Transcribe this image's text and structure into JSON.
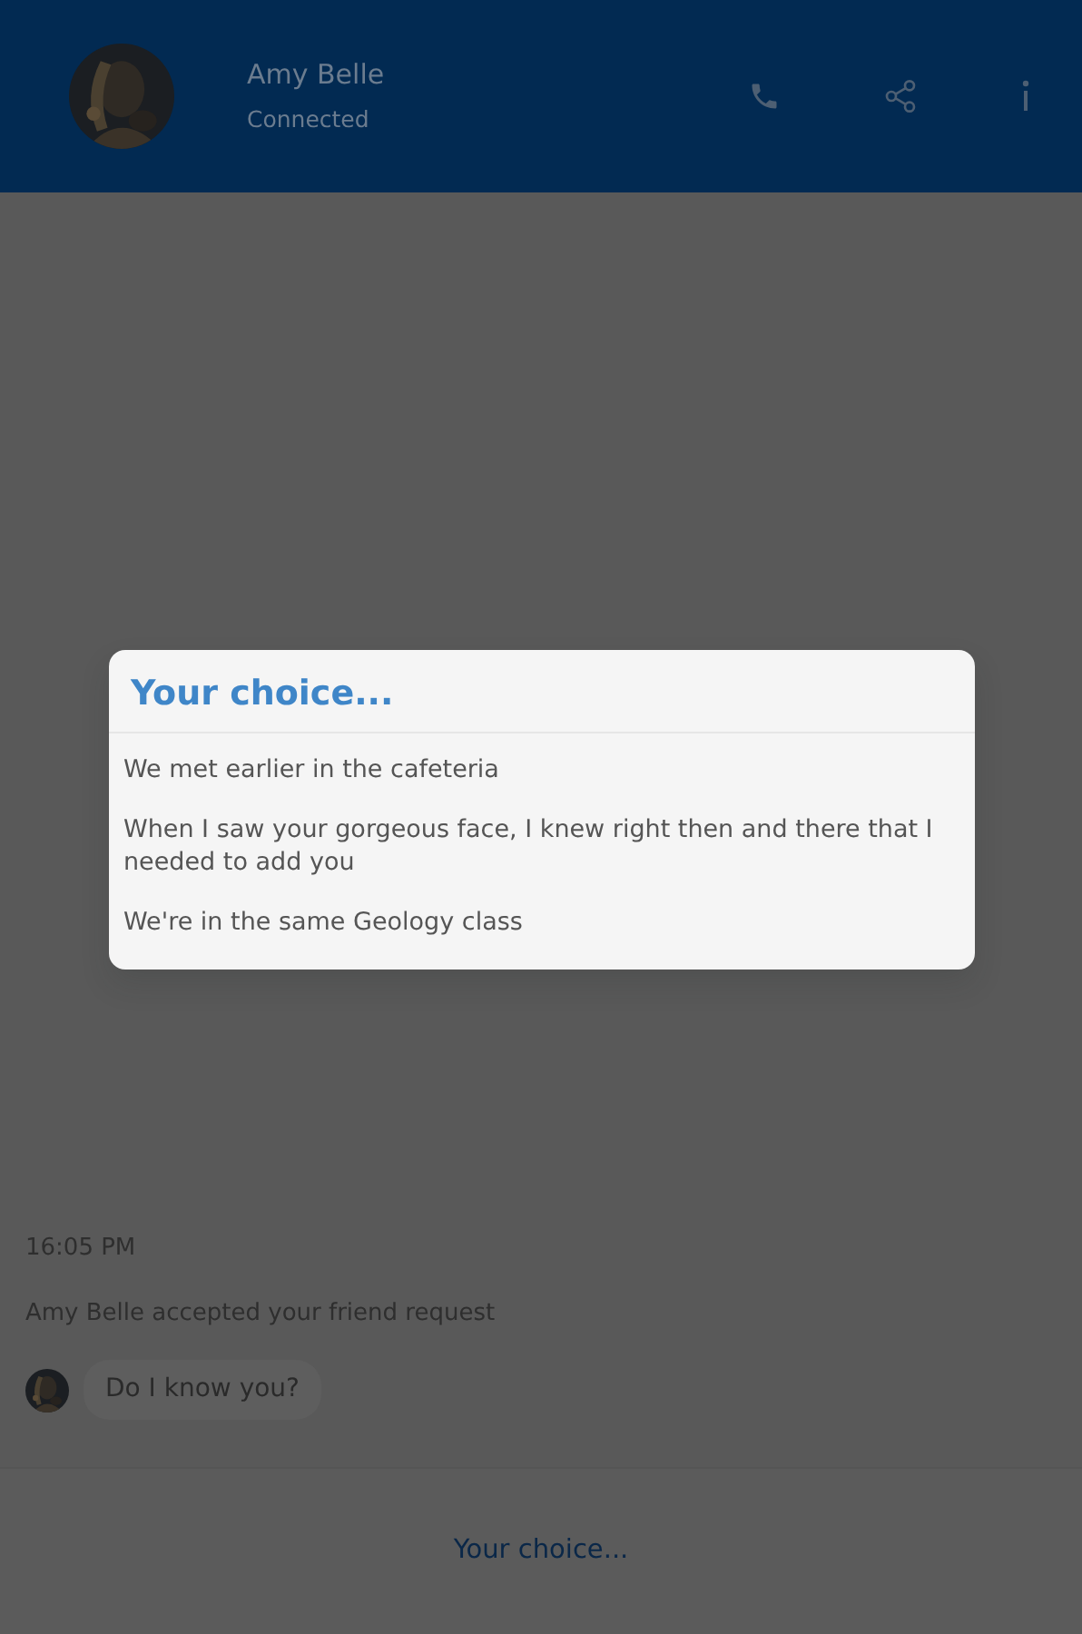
{
  "header": {
    "contact_name": "Amy Belle",
    "status": "Connected"
  },
  "chat": {
    "timestamp": "16:05 PM",
    "system_message": "Amy Belle accepted your friend request",
    "messages": [
      {
        "text": "Do I know you?"
      }
    ]
  },
  "reply_bar": {
    "label": "Your choice..."
  },
  "dialog": {
    "title": "Your choice...",
    "options": [
      {
        "text": "We met earlier in the cafeteria"
      },
      {
        "text": "When I saw your gorgeous face, I knew right then and there that I needed to add you"
      },
      {
        "text": "We're in the same Geology class"
      }
    ]
  }
}
